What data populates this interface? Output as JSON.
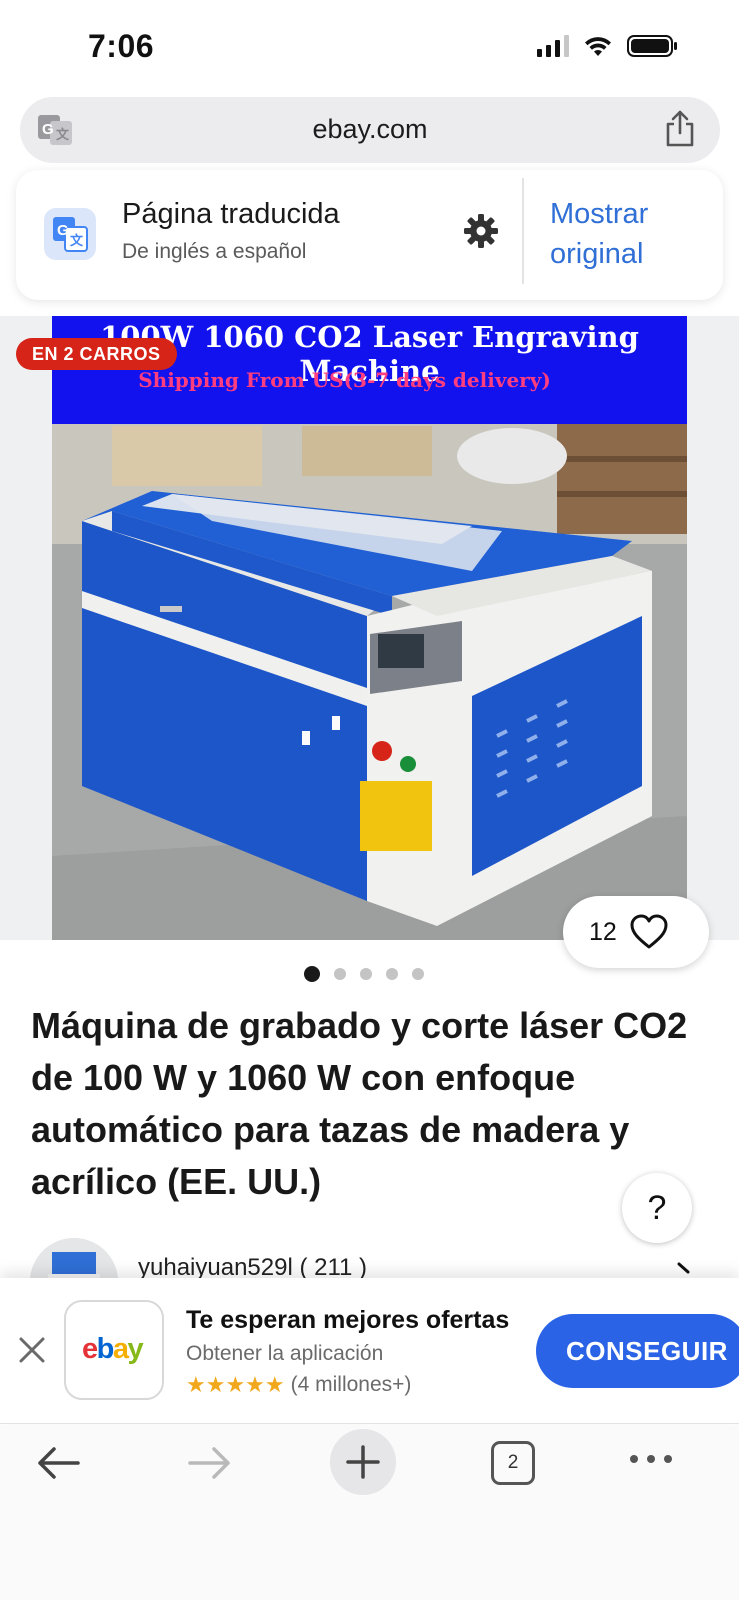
{
  "status_bar": {
    "time": "7:06",
    "icons": [
      "cellular-signal-icon",
      "wifi-icon",
      "battery-icon"
    ]
  },
  "browser": {
    "url": "ebay.com",
    "left_icon": "translate-icon",
    "right_icon": "share-icon"
  },
  "translate_banner": {
    "title": "Página traducida",
    "subtitle": "De inglés a español",
    "show_original_line1": "Mostrar",
    "show_original_line2": "original",
    "accent_color": "#2f6fd6"
  },
  "product_image": {
    "banner_line1": "100W 1060 CO2 Laser Engraving Machine",
    "banner_line2": "Shipping From US(3-7 days delivery)",
    "cart_badge": "EN 2 CARROS",
    "like_count": "12",
    "carousel_count": 5,
    "carousel_active_index": 0
  },
  "product": {
    "title": "Máquina de grabado y corte láser CO2 de 100 W y 1060 W con enfoque automático para tazas de madera y acrílico (EE. UU.)"
  },
  "help_label": "?",
  "seller": {
    "name": "yuhaiyuan529l ( 211 )"
  },
  "app_banner": {
    "app_name": "ebay",
    "title": "Te esperan mejores ofertas",
    "subtitle": "Obtener la aplicación",
    "stars": "★★★★★",
    "rating_count": "(4 millones+)",
    "cta": "CONSEGUIR",
    "cta_color": "#2a63e6"
  },
  "toolbar": {
    "tab_count": "2",
    "icons": [
      "back-arrow-icon",
      "forward-arrow-icon",
      "plus-icon",
      "tabs-icon",
      "more-icon"
    ]
  },
  "colors": {
    "ebay_red": "#e53238",
    "ebay_blue": "#0064d2",
    "ebay_yellow": "#f5af02",
    "ebay_green": "#86b817",
    "badge_red": "#d62418"
  }
}
